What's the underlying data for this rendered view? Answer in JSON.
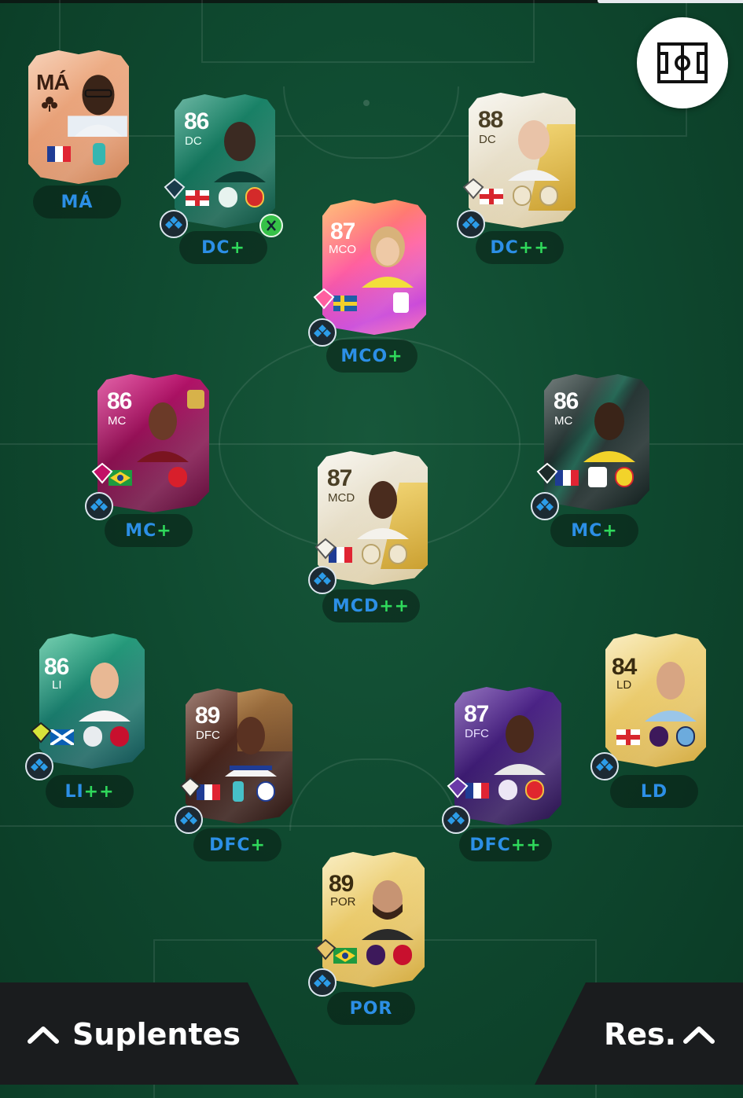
{
  "app": {
    "formation_button_icon": "pitch-formation-icon"
  },
  "bottom": {
    "subs_label": "Suplentes",
    "reserves_label": "Res."
  },
  "players": [
    {
      "id": "manager",
      "rating": "MÁ",
      "pos": "",
      "label": "MÁ",
      "suffix": "",
      "flag": "France",
      "theme": "bronze"
    },
    {
      "id": "dc1",
      "rating": "86",
      "pos": "DC",
      "label": "DC",
      "suffix": "+",
      "flag": "England",
      "theme": "teal",
      "club": "Manchester United",
      "league": "Premier League"
    },
    {
      "id": "dc2",
      "rating": "88",
      "pos": "DC",
      "label": "DC",
      "suffix": "++",
      "flag": "England",
      "theme": "icon"
    },
    {
      "id": "mco",
      "rating": "87",
      "pos": "MCO",
      "label": "MCO",
      "suffix": "+",
      "flag": "Sweden",
      "theme": "fantasy",
      "league": "Serie A"
    },
    {
      "id": "mc1",
      "rating": "86",
      "pos": "MC",
      "label": "MC",
      "suffix": "+",
      "flag": "Brazil",
      "theme": "pink",
      "league": "Bundesliga"
    },
    {
      "id": "mcd",
      "rating": "87",
      "pos": "MCD",
      "label": "MCD",
      "suffix": "++",
      "flag": "France",
      "theme": "icon"
    },
    {
      "id": "mc2",
      "rating": "86",
      "pos": "MC",
      "label": "MC",
      "suffix": "+",
      "flag": "France",
      "theme": "darkteal",
      "club": "Watford",
      "league": "EFL"
    },
    {
      "id": "li",
      "rating": "86",
      "pos": "LI",
      "label": "LI",
      "suffix": "++",
      "flag": "Scotland",
      "theme": "green",
      "club": "Liverpool",
      "league": "Premier League"
    },
    {
      "id": "dfc1",
      "rating": "89",
      "pos": "DFC",
      "label": "DFC",
      "suffix": "+",
      "flag": "France",
      "theme": "brown",
      "club": "OL"
    },
    {
      "id": "dfc2",
      "rating": "87",
      "pos": "DFC",
      "label": "DFC",
      "suffix": "++",
      "flag": "France",
      "theme": "purple",
      "club": "Arsenal",
      "league": "Premier League"
    },
    {
      "id": "ld",
      "rating": "84",
      "pos": "LD",
      "label": "LD",
      "suffix": "",
      "flag": "England",
      "theme": "gold",
      "club": "Manchester City",
      "league": "Premier League"
    },
    {
      "id": "por",
      "rating": "89",
      "pos": "POR",
      "label": "POR",
      "suffix": "",
      "flag": "Brazil",
      "theme": "gold",
      "club": "Liverpool",
      "league": "Premier League"
    }
  ],
  "colors": {
    "pitch": "#0f4a30",
    "chem_plus": "#2fd95b",
    "position_blue": "#2c8fe6",
    "panel": "#1a1c1e"
  }
}
